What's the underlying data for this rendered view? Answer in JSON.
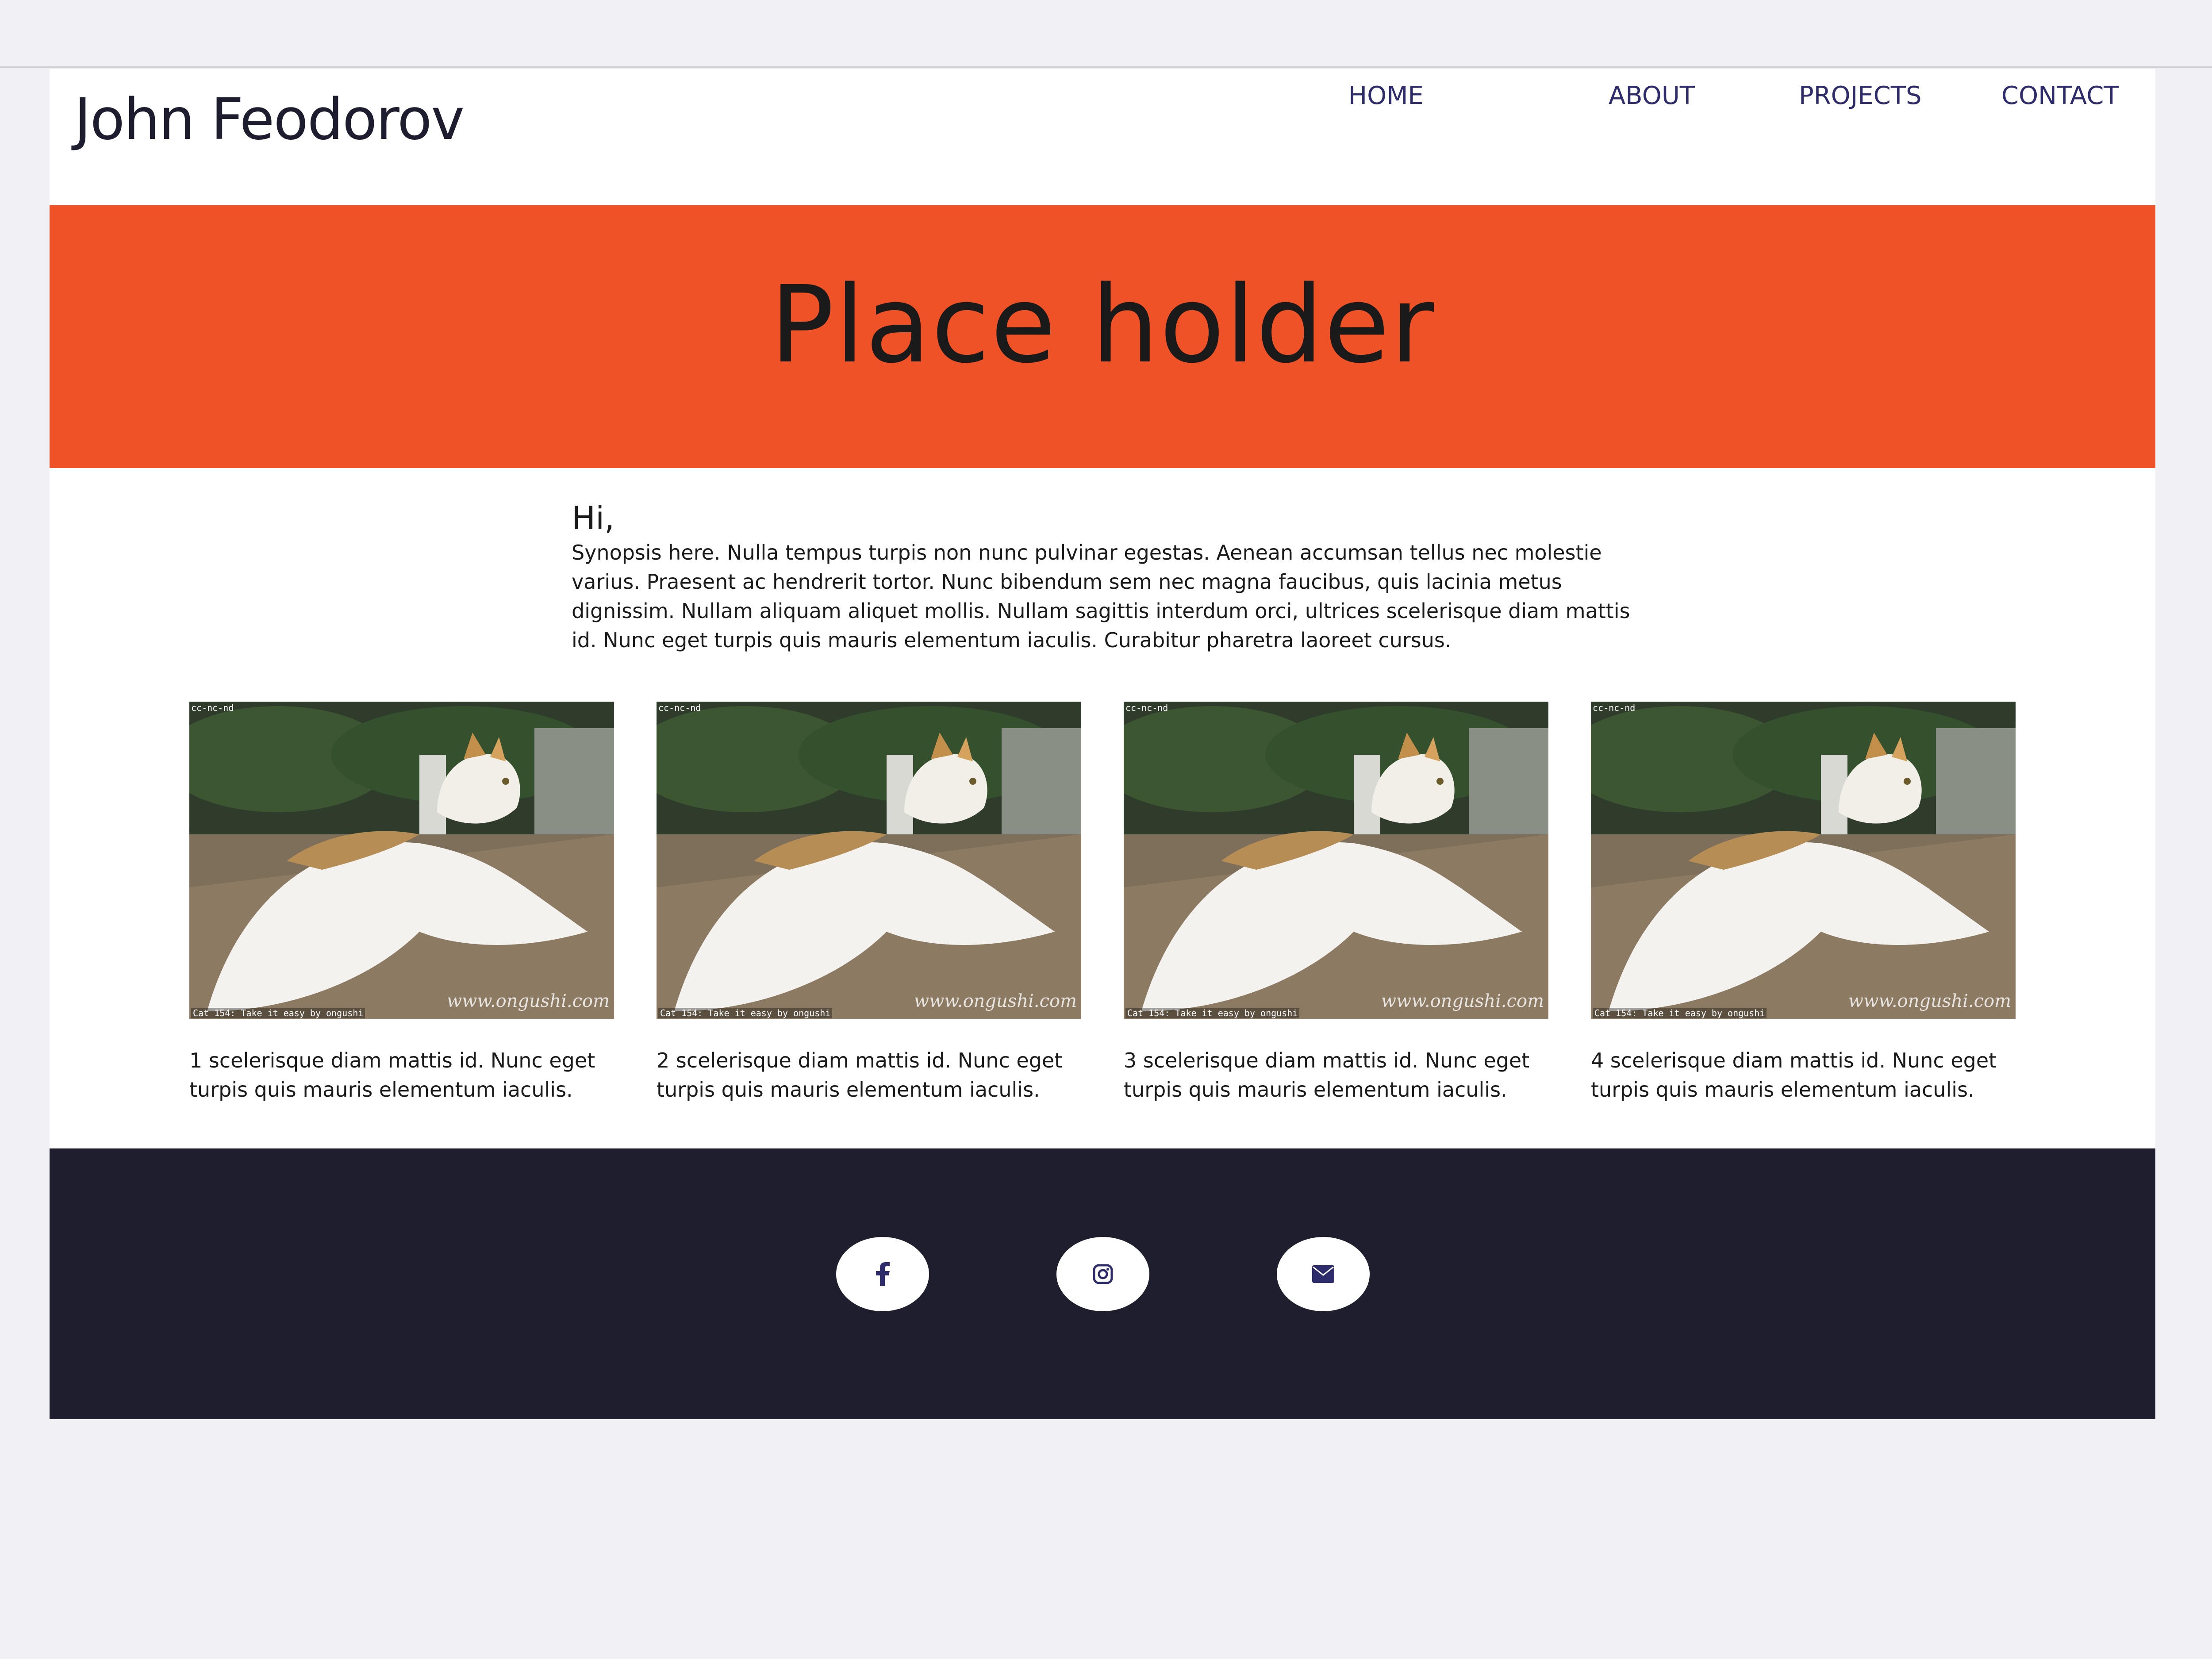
{
  "site": {
    "title": "John Feodorov"
  },
  "nav": {
    "items": [
      {
        "label": "HOME"
      },
      {
        "label": "ABOUT"
      },
      {
        "label": "PROJECTS"
      },
      {
        "label": "CONTACT"
      }
    ]
  },
  "hero": {
    "title": "Place holder"
  },
  "intro": {
    "greeting": "Hi,",
    "body": "Synopsis here. Nulla tempus turpis non nunc pulvinar egestas. Aenean accumsan tellus nec molestie varius. Praesent ac hendrerit tortor. Nunc bibendum sem nec magna faucibus, quis lacinia metus dignissim. Nullam aliquam aliquet mollis. Nullam sagittis interdum orci, ultrices scelerisque diam mattis id. Nunc eget turpis quis mauris elementum iaculis. Curabitur pharetra laoreet cursus."
  },
  "gallery": {
    "image_tag": "cc-nc-nd",
    "image_credit": "Cat 154: Take it easy by ongushi",
    "image_watermark": "www.ongushi.com",
    "cards": [
      {
        "caption": "1 scelerisque diam mattis id. Nunc eget turpis quis mauris elementum iaculis."
      },
      {
        "caption": "2 scelerisque diam mattis id. Nunc eget turpis quis mauris elementum iaculis."
      },
      {
        "caption": "3 scelerisque diam mattis id. Nunc eget turpis quis mauris elementum iaculis."
      },
      {
        "caption": "4 scelerisque diam mattis id. Nunc eget turpis quis mauris elementum iaculis."
      }
    ]
  },
  "footer": {
    "social": [
      {
        "icon": "facebook-icon"
      },
      {
        "icon": "instagram-icon"
      },
      {
        "icon": "envelope-icon"
      }
    ]
  },
  "colors": {
    "accent": "#ef5226",
    "footer_bg": "#1f1e2e",
    "nav_text": "#2e2c6b",
    "page_bg": "#f0f0f5"
  }
}
